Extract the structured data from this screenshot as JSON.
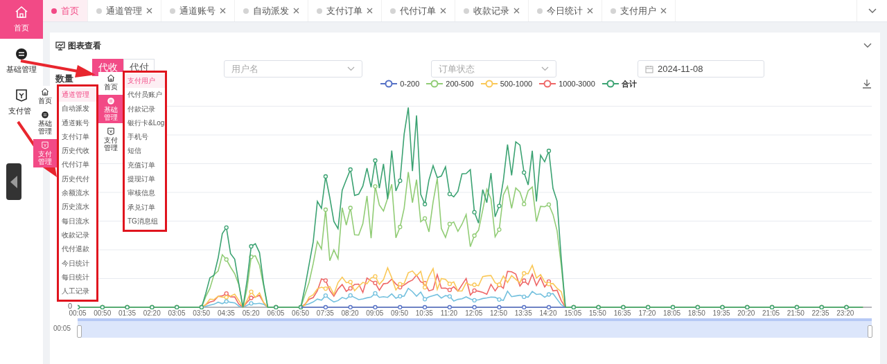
{
  "sidebar": {
    "items": [
      {
        "label": "首页",
        "selected": true
      },
      {
        "label": "基础管理",
        "selected": false
      },
      {
        "label": "支付管",
        "selected": false
      }
    ]
  },
  "tabs": [
    {
      "label": "首页",
      "selected": true,
      "closable": false
    },
    {
      "label": "通道管理",
      "selected": false,
      "closable": true
    },
    {
      "label": "通道账号",
      "selected": false,
      "closable": true
    },
    {
      "label": "自动派发",
      "selected": false,
      "closable": true
    },
    {
      "label": "支付订单",
      "selected": false,
      "closable": true
    },
    {
      "label": "代付订单",
      "selected": false,
      "closable": true
    },
    {
      "label": "收款记录",
      "selected": false,
      "closable": true
    },
    {
      "label": "今日统计",
      "selected": false,
      "closable": true
    },
    {
      "label": "支付用户",
      "selected": false,
      "closable": true
    }
  ],
  "card": {
    "title": "图表查看",
    "mode_switch": [
      {
        "label": "代收",
        "selected": true
      },
      {
        "label": "代付",
        "selected": false
      }
    ],
    "filters": [
      {
        "kind": "select",
        "placeholder": "用户名"
      },
      {
        "kind": "select",
        "placeholder": "订单状态"
      },
      {
        "kind": "date",
        "value": "2024-11-08"
      }
    ],
    "y_axis_name": "数量",
    "legend": [
      {
        "label": "0-200",
        "color": "#5470c6"
      },
      {
        "label": "200-500",
        "color": "#91cc75"
      },
      {
        "label": "500-1000",
        "color": "#fac858"
      },
      {
        "label": "1000-3000",
        "color": "#ee6666"
      },
      {
        "label": "合计",
        "color": "#3ba272"
      }
    ],
    "y_axis_labels": [
      "0"
    ],
    "x_axis_labels": [
      "00:05",
      "00:50",
      "01:35",
      "02:20",
      "03:05",
      "03:50",
      "04:35",
      "05:20",
      "06:05",
      "06:50",
      "07:35",
      "08:20",
      "09:05",
      "09:50",
      "10:35",
      "11:20",
      "12:05",
      "12:50",
      "13:35",
      "14:20",
      "15:05",
      "15:50",
      "16:35",
      "17:20",
      "18:05",
      "18:50",
      "19:35",
      "20:20",
      "21:05",
      "21:50",
      "22:35",
      "23:20"
    ],
    "zoom": {
      "start_label": "00:05",
      "level": 1
    }
  },
  "overlays": {
    "mini_sidebar_left": [
      {
        "label": "首页",
        "selected": false
      },
      {
        "label": "基础管理",
        "selected": false
      },
      {
        "label": "支付管理",
        "selected": true
      }
    ],
    "menu_left": [
      {
        "label": "通道管理",
        "selected": true
      },
      {
        "label": "自动派发",
        "selected": false
      },
      {
        "label": "通道账号",
        "selected": false
      },
      {
        "label": "支付订单",
        "selected": false
      },
      {
        "label": "历史代收",
        "selected": false
      },
      {
        "label": "代付订单",
        "selected": false
      },
      {
        "label": "历史代付",
        "selected": false
      },
      {
        "label": "余额流水",
        "selected": false
      },
      {
        "label": "历史流水",
        "selected": false
      },
      {
        "label": "每日流水",
        "selected": false
      },
      {
        "label": "收款记录",
        "selected": false
      },
      {
        "label": "代付退款",
        "selected": false
      },
      {
        "label": "今日统计",
        "selected": false
      },
      {
        "label": "每日统计",
        "selected": false
      },
      {
        "label": "人工记录",
        "selected": false
      }
    ],
    "mini_sidebar_right": [
      {
        "label": "首页",
        "selected": false
      },
      {
        "label": "基础管理",
        "selected": true
      },
      {
        "label": "支付管理",
        "selected": false
      }
    ],
    "menu_right": [
      {
        "label": "支付用户",
        "selected": true
      },
      {
        "label": "代付员账户",
        "selected": false
      },
      {
        "label": "付款记录",
        "selected": false
      },
      {
        "label": "银行卡&Log",
        "selected": false
      },
      {
        "label": "手机号",
        "selected": false
      },
      {
        "label": "短信",
        "selected": false
      },
      {
        "label": "充值订单",
        "selected": false
      },
      {
        "label": "提现订单",
        "selected": false
      },
      {
        "label": "审核信息",
        "selected": false
      },
      {
        "label": "承兑订单",
        "selected": false
      },
      {
        "label": "TG消息组",
        "selected": false
      }
    ]
  }
}
